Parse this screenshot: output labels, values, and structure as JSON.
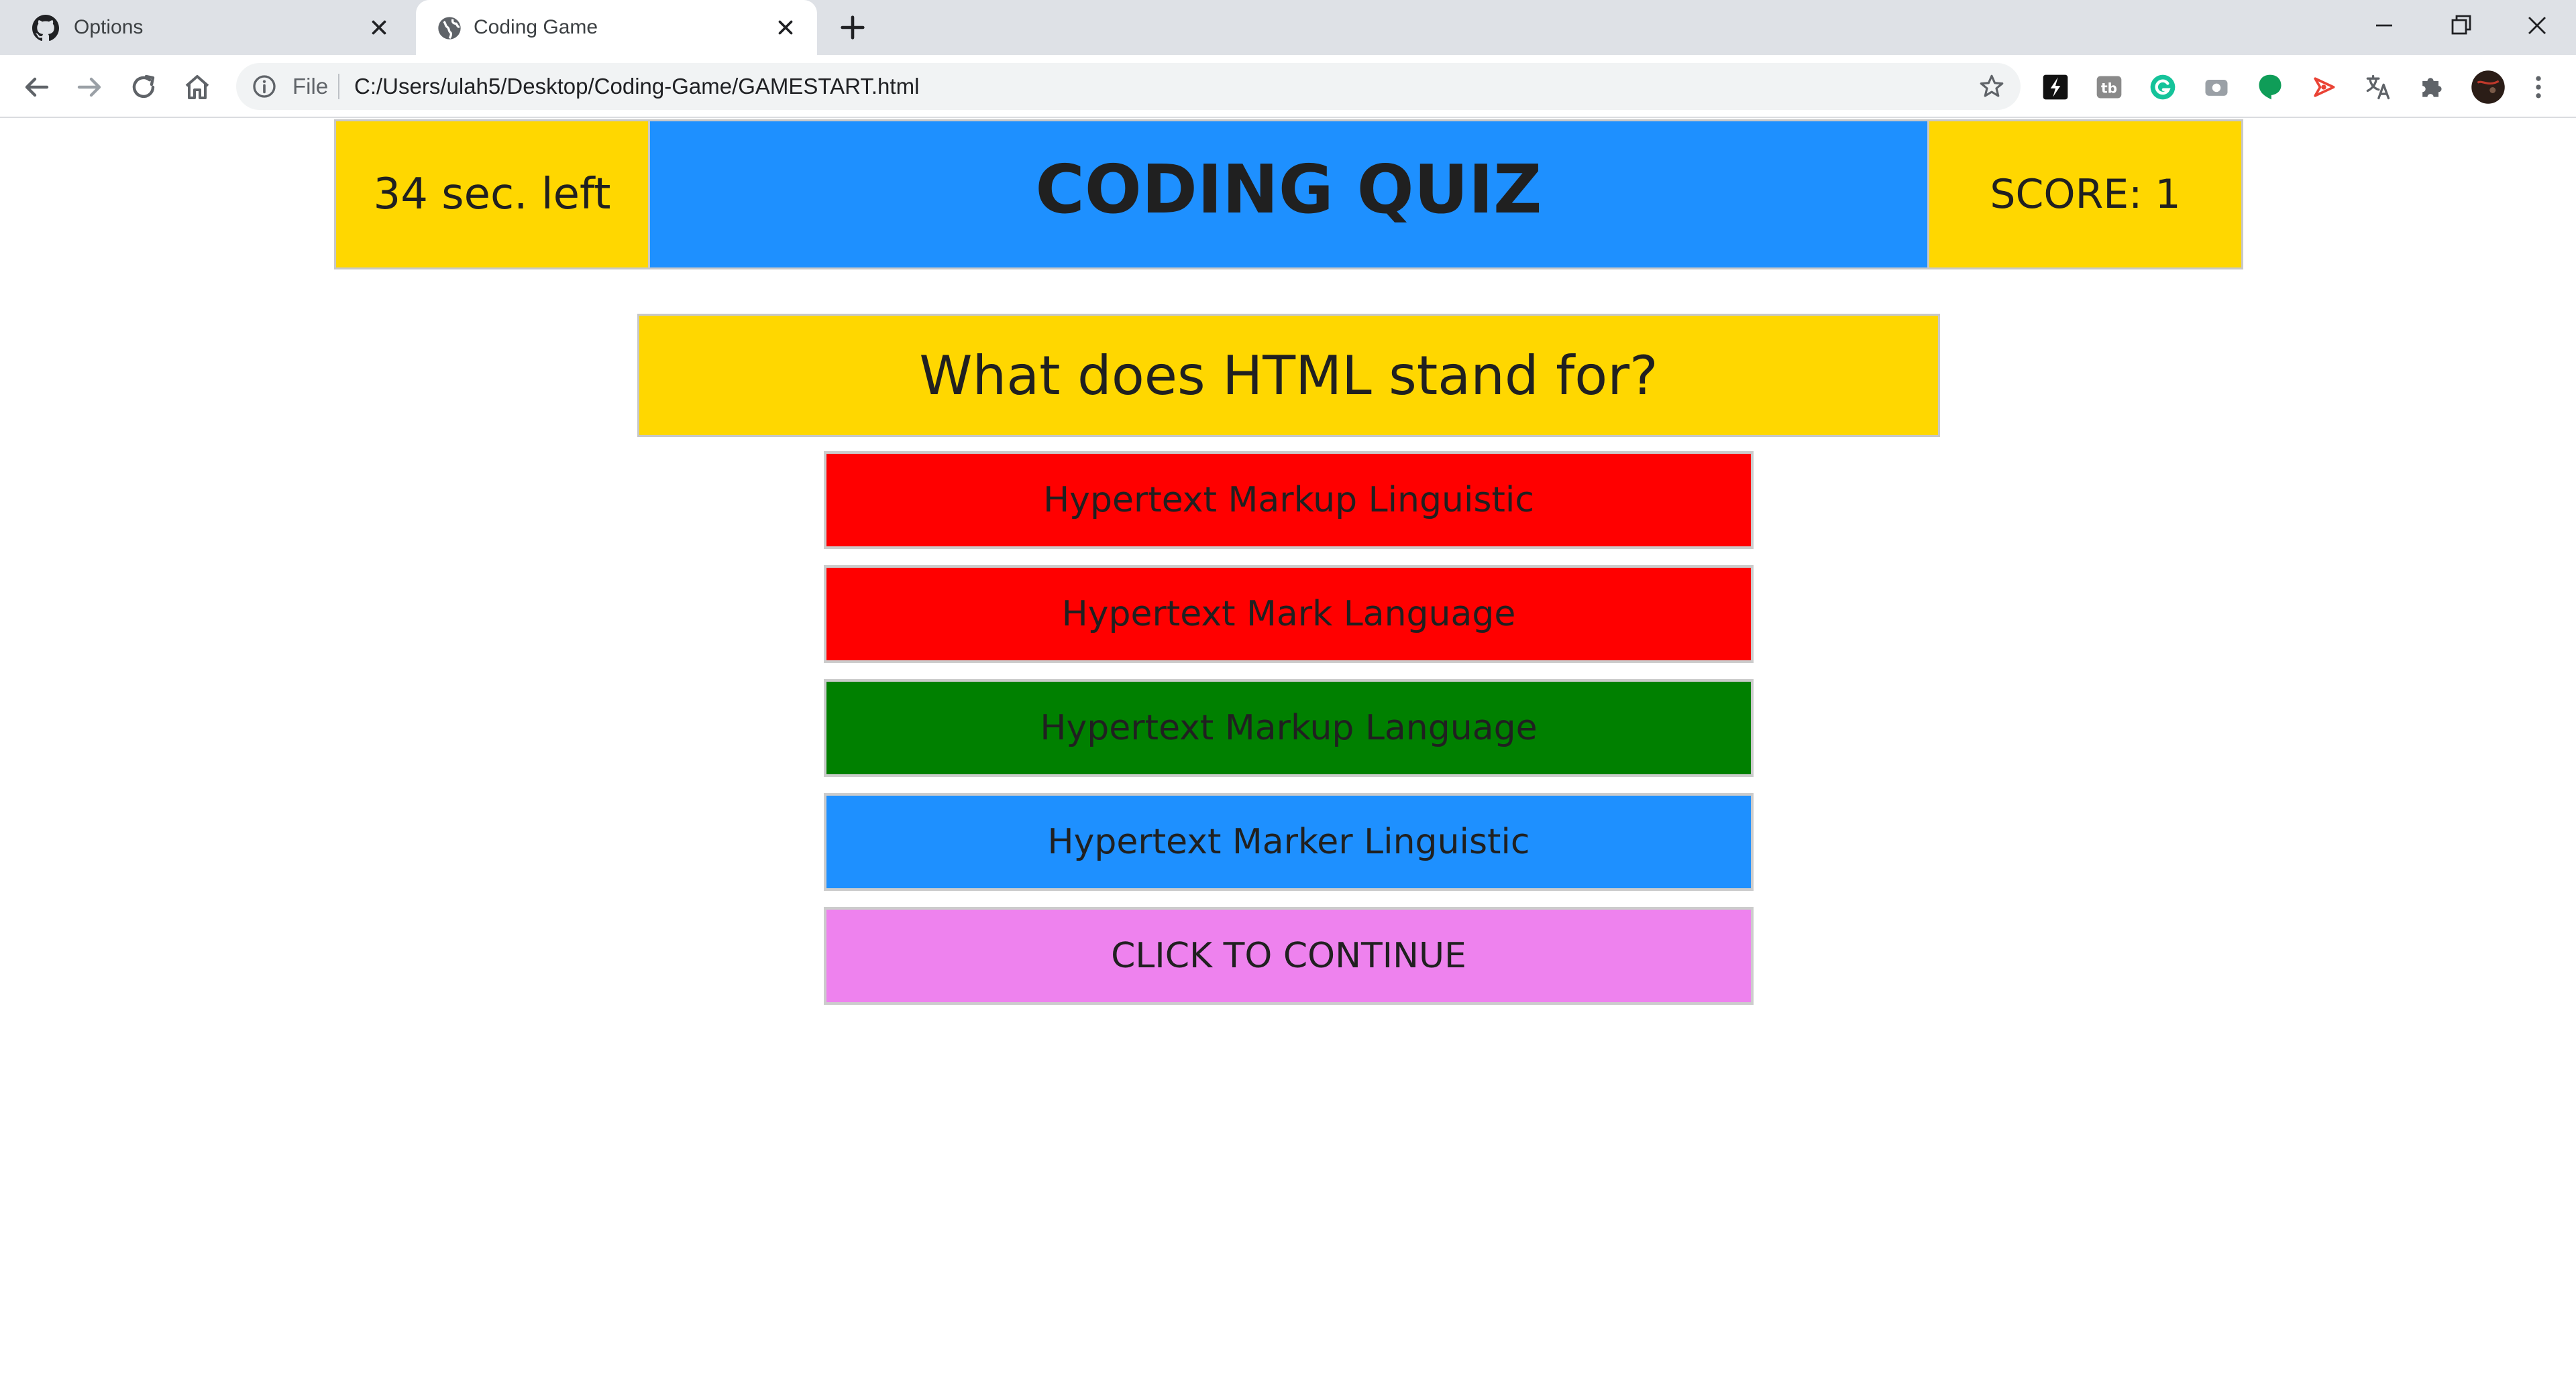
{
  "browser": {
    "tabs": [
      {
        "title": "Options",
        "favicon": "github-icon",
        "active": false
      },
      {
        "title": "Coding Game",
        "favicon": "globe-icon",
        "active": true
      }
    ],
    "address_bar": {
      "scheme_label": "File",
      "url": "C:/Users/ulah5/Desktop/Coding-Game/GAMESTART.html"
    },
    "extensions": [
      "dark-reader-icon",
      "tb-icon",
      "grammarly-icon",
      "screenshot-icon",
      "chat-bubble-icon",
      "streaming-icon",
      "translate-icon",
      "puzzle-icon",
      "profile-avatar"
    ]
  },
  "quiz": {
    "timer_text": "34 sec. left",
    "title": "CODING QUIZ",
    "score_text": "SCORE: 1",
    "question": "What does HTML stand for?",
    "answers": [
      {
        "text": "Hypertext Markup Linguistic",
        "color": "#ff0000"
      },
      {
        "text": "Hypertext Mark Language",
        "color": "#ff0000"
      },
      {
        "text": "Hypertext Markup Language",
        "color": "#008000"
      },
      {
        "text": "Hypertext Marker Linguistic",
        "color": "#1e90ff"
      }
    ],
    "continue_label": "CLICK TO CONTINUE"
  },
  "colors": {
    "header_side": "#ffd700",
    "header_title": "#1e90ff",
    "continue": "#ee82ee"
  }
}
